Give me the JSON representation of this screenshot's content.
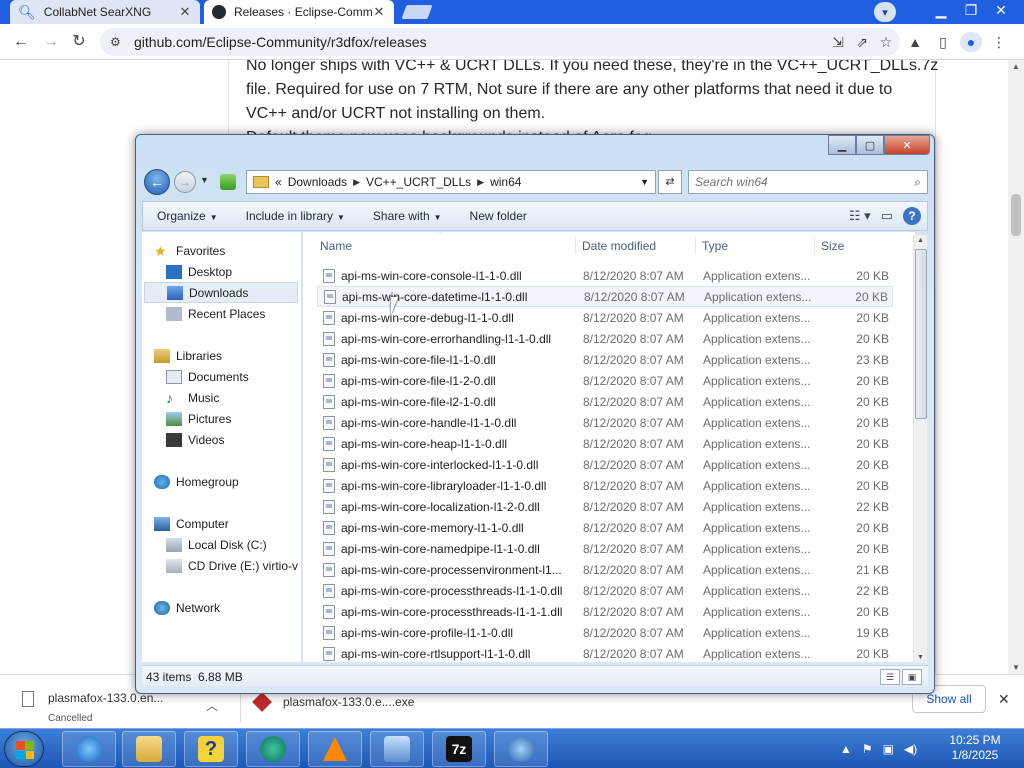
{
  "browser": {
    "tabs": [
      {
        "title": "CollabNet SearXNG",
        "icon": "search-icon",
        "close": "✕"
      },
      {
        "title": "Releases · Eclipse-Commu",
        "icon": "github-icon",
        "close": "✕"
      }
    ],
    "url": "github.com/Eclipse-Community/r3dfox/releases"
  },
  "page": {
    "lines": [
      "No longer ships with VC++ & UCRT DLLs. If you need these, they're in the VC++_UCRT_DLLs.7z",
      "file. Required for use on 7 RTM, Not sure if there are any other platforms that need it due to",
      "VC++ and/or UCRT not installing on them.",
      "Default theme now uses backgrounds instead of Aero fog."
    ]
  },
  "explorer": {
    "breadcrumb": {
      "prefix": "«",
      "parts": [
        "Downloads",
        "VC++_UCRT_DLLs",
        "win64"
      ]
    },
    "search_placeholder": "Search win64",
    "commands": {
      "organize": "Organize",
      "include": "Include in library",
      "share": "Share with",
      "newfolder": "New folder"
    },
    "nav": {
      "favorites": "Favorites",
      "desktop": "Desktop",
      "downloads": "Downloads",
      "recent": "Recent Places",
      "libraries": "Libraries",
      "documents": "Documents",
      "music": "Music",
      "pictures": "Pictures",
      "videos": "Videos",
      "homegroup": "Homegroup",
      "computer": "Computer",
      "localdisk": "Local Disk (C:)",
      "cddrive": "CD Drive (E:) virtio-v",
      "network": "Network"
    },
    "columns": {
      "name": "Name",
      "date": "Date modified",
      "type": "Type",
      "size": "Size"
    },
    "files": [
      {
        "name": "api-ms-win-core-console-l1-1-0.dll",
        "date": "8/12/2020 8:07 AM",
        "type": "Application extens...",
        "size": "20 KB"
      },
      {
        "name": "api-ms-win-core-datetime-l1-1-0.dll",
        "date": "8/12/2020 8:07 AM",
        "type": "Application extens...",
        "size": "20 KB"
      },
      {
        "name": "api-ms-win-core-debug-l1-1-0.dll",
        "date": "8/12/2020 8:07 AM",
        "type": "Application extens...",
        "size": "20 KB"
      },
      {
        "name": "api-ms-win-core-errorhandling-l1-1-0.dll",
        "date": "8/12/2020 8:07 AM",
        "type": "Application extens...",
        "size": "20 KB"
      },
      {
        "name": "api-ms-win-core-file-l1-1-0.dll",
        "date": "8/12/2020 8:07 AM",
        "type": "Application extens...",
        "size": "23 KB"
      },
      {
        "name": "api-ms-win-core-file-l1-2-0.dll",
        "date": "8/12/2020 8:07 AM",
        "type": "Application extens...",
        "size": "20 KB"
      },
      {
        "name": "api-ms-win-core-file-l2-1-0.dll",
        "date": "8/12/2020 8:07 AM",
        "type": "Application extens...",
        "size": "20 KB"
      },
      {
        "name": "api-ms-win-core-handle-l1-1-0.dll",
        "date": "8/12/2020 8:07 AM",
        "type": "Application extens...",
        "size": "20 KB"
      },
      {
        "name": "api-ms-win-core-heap-l1-1-0.dll",
        "date": "8/12/2020 8:07 AM",
        "type": "Application extens...",
        "size": "20 KB"
      },
      {
        "name": "api-ms-win-core-interlocked-l1-1-0.dll",
        "date": "8/12/2020 8:07 AM",
        "type": "Application extens...",
        "size": "20 KB"
      },
      {
        "name": "api-ms-win-core-libraryloader-l1-1-0.dll",
        "date": "8/12/2020 8:07 AM",
        "type": "Application extens...",
        "size": "20 KB"
      },
      {
        "name": "api-ms-win-core-localization-l1-2-0.dll",
        "date": "8/12/2020 8:07 AM",
        "type": "Application extens...",
        "size": "22 KB"
      },
      {
        "name": "api-ms-win-core-memory-l1-1-0.dll",
        "date": "8/12/2020 8:07 AM",
        "type": "Application extens...",
        "size": "20 KB"
      },
      {
        "name": "api-ms-win-core-namedpipe-l1-1-0.dll",
        "date": "8/12/2020 8:07 AM",
        "type": "Application extens...",
        "size": "20 KB"
      },
      {
        "name": "api-ms-win-core-processenvironment-l1...",
        "date": "8/12/2020 8:07 AM",
        "type": "Application extens...",
        "size": "21 KB"
      },
      {
        "name": "api-ms-win-core-processthreads-l1-1-0.dll",
        "date": "8/12/2020 8:07 AM",
        "type": "Application extens...",
        "size": "22 KB"
      },
      {
        "name": "api-ms-win-core-processthreads-l1-1-1.dll",
        "date": "8/12/2020 8:07 AM",
        "type": "Application extens...",
        "size": "20 KB"
      },
      {
        "name": "api-ms-win-core-profile-l1-1-0.dll",
        "date": "8/12/2020 8:07 AM",
        "type": "Application extens...",
        "size": "19 KB"
      },
      {
        "name": "api-ms-win-core-rtlsupport-l1-1-0.dll",
        "date": "8/12/2020 8:07 AM",
        "type": "Application extens...",
        "size": "20 KB"
      }
    ],
    "status": "43 items  6.88 MB"
  },
  "downloads": {
    "item1": {
      "name": "plasmafox-133.0.en...",
      "status": "Cancelled"
    },
    "item2": {
      "name": "plasmafox-133.0.e....exe"
    },
    "show_all": "Show all"
  },
  "clock": {
    "time": "10:25 PM",
    "date": "1/8/2025"
  },
  "colors": {
    "tabbar": "#1f5fe0",
    "taskbar": "#2b6ac8",
    "accent": "#1a56c9"
  }
}
